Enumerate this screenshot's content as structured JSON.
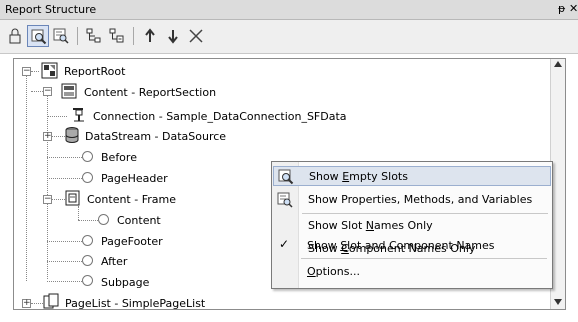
{
  "panel": {
    "title": "Report Structure",
    "pin_glyph": "ᵽ",
    "close_glyph": "✕"
  },
  "toolbar": {
    "buttons": [
      "lock-icon",
      "show-empty-slots-icon",
      "show-properties-icon",
      "expand-structure-icon",
      "collapse-structure-icon",
      "move-up-icon",
      "move-down-icon",
      "delete-icon"
    ],
    "active": "show-empty-slots-icon"
  },
  "tree": {
    "nodes": [
      {
        "label": "ReportRoot",
        "icon": "report-root-icon",
        "toggle": "−"
      },
      {
        "label": "Content - ReportSection",
        "icon": "report-section-icon",
        "toggle": "−"
      },
      {
        "label": "Connection - Sample_DataConnection_SFData",
        "icon": "connection-icon"
      },
      {
        "label": "DataStream - DataSource",
        "icon": "datastream-icon",
        "toggle": "+"
      },
      {
        "label": "Before",
        "icon": "empty-slot-icon"
      },
      {
        "label": "PageHeader",
        "icon": "empty-slot-icon"
      },
      {
        "label": "Content - Frame",
        "icon": "frame-icon",
        "toggle": "−"
      },
      {
        "label": "Content",
        "icon": "empty-slot-icon"
      },
      {
        "label": "PageFooter",
        "icon": "empty-slot-icon"
      },
      {
        "label": "After",
        "icon": "empty-slot-icon"
      },
      {
        "label": "Subpage",
        "icon": "empty-slot-icon"
      },
      {
        "label": "PageList - SimplePageList",
        "icon": "pagelist-icon",
        "toggle": "+"
      }
    ]
  },
  "context_menu": {
    "items": [
      {
        "label": "Show Empty Slots",
        "mnemonic_index": 5,
        "icon": "show-empty-slots-icon",
        "highlighted": true
      },
      {
        "label": "Show Properties, Methods, and Variables",
        "icon": "show-properties-icon"
      },
      {
        "label": "Show Slot Names Only",
        "mnemonic_index": 10
      },
      {
        "label": "Show Component Names Only",
        "mnemonic_index": 5
      },
      {
        "label": "Show Slot and Component Names",
        "mnemonic_index": 5,
        "checked": true
      },
      {
        "label": "Options...",
        "mnemonic_index": 0
      }
    ],
    "check_glyph": "✓"
  },
  "colors": {
    "titlebar": "#dcdcdc",
    "highlight": "#dde4ee",
    "highlight_border": "#9bafcf"
  }
}
